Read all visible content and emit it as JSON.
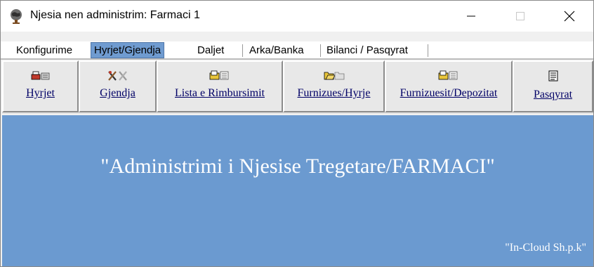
{
  "window": {
    "title": "Njesia nen administrim: Farmaci 1",
    "icon": "world-globe-icon"
  },
  "tabs": [
    {
      "label": "Konfigurime",
      "active": false
    },
    {
      "label": "Hyrjet/Gjendja",
      "active": true
    },
    {
      "label": "Daljet",
      "active": false
    },
    {
      "label": "Arka/Banka",
      "active": false
    },
    {
      "label": "Bilanci / Pasqyrat",
      "active": false
    }
  ],
  "toolbar": [
    {
      "label": "Hyrjet",
      "icon": "cash-register-icon"
    },
    {
      "label": "Gjendja",
      "icon": "tools-icon"
    },
    {
      "label": "Lista e Rimbursimit",
      "icon": "folder-documents-icon"
    },
    {
      "label": "Furnizues/Hyrje",
      "icon": "open-folders-icon"
    },
    {
      "label": "Furnizuesit/Depozitat",
      "icon": "folder-documents-icon"
    },
    {
      "label": "Pasqyrat",
      "icon": "report-sheet-icon"
    }
  ],
  "main": {
    "title": "\"Administrimi i Njesise Tregetare/FARMACI\"",
    "credit": "\"In-Cloud Sh.p.k\""
  },
  "colors": {
    "main_background": "#6b9ad0",
    "active_tab": "#6f9bd0",
    "toolbar_text": "#000066"
  }
}
